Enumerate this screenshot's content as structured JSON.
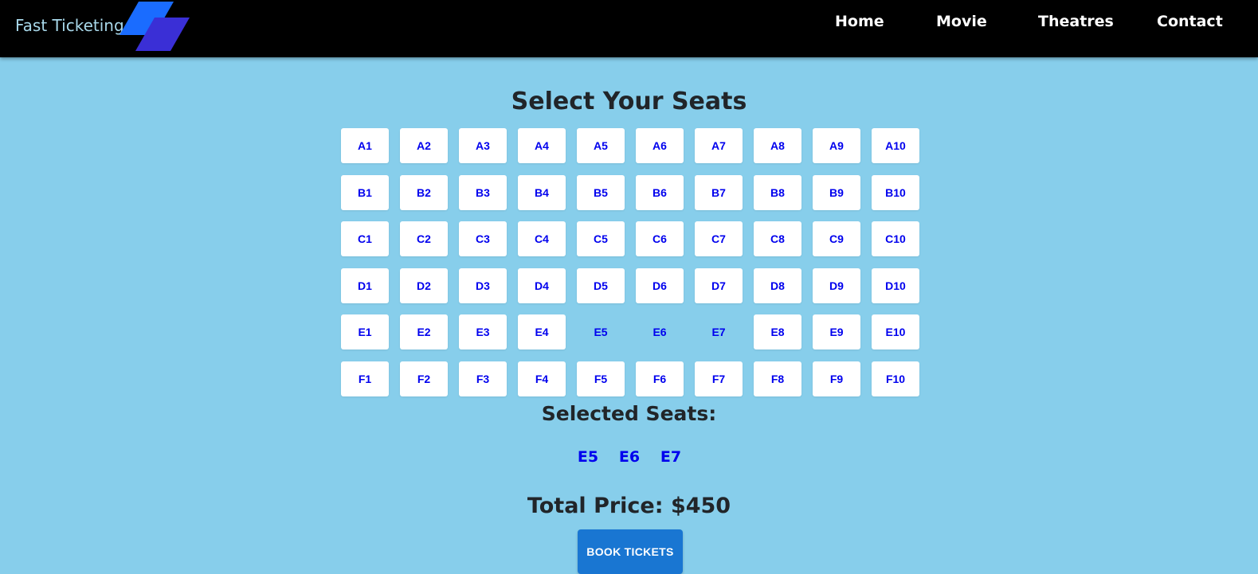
{
  "brand": {
    "name": "Fast Ticketing"
  },
  "nav": {
    "home": "Home",
    "movie": "Movie",
    "theatres": "Theatres",
    "contact": "Contact"
  },
  "page": {
    "title": "Select Your Seats"
  },
  "colors": {
    "background": "#87ceeb",
    "navbar": "#000000",
    "seat_text": "#0000ee",
    "book_button": "#1976d2",
    "logo_front": "#1a6cff",
    "logo_back": "#3a2fd6"
  },
  "seats": {
    "rows": [
      [
        "A1",
        "A2",
        "A3",
        "A4",
        "A5",
        "A6",
        "A7",
        "A8",
        "A9",
        "A10"
      ],
      [
        "B1",
        "B2",
        "B3",
        "B4",
        "B5",
        "B6",
        "B7",
        "B8",
        "B9",
        "B10"
      ],
      [
        "C1",
        "C2",
        "C3",
        "C4",
        "C5",
        "C6",
        "C7",
        "C8",
        "C9",
        "C10"
      ],
      [
        "D1",
        "D2",
        "D3",
        "D4",
        "D5",
        "D6",
        "D7",
        "D8",
        "D9",
        "D10"
      ],
      [
        "E1",
        "E2",
        "E3",
        "E4",
        "E5",
        "E6",
        "E7",
        "E8",
        "E9",
        "E10"
      ],
      [
        "F1",
        "F2",
        "F3",
        "F4",
        "F5",
        "F6",
        "F7",
        "F8",
        "F9",
        "F10"
      ]
    ],
    "selected": [
      "E5",
      "E6",
      "E7"
    ]
  },
  "summary": {
    "selected_label": "Selected Seats:",
    "selected_list": [
      "E5",
      "E6",
      "E7"
    ],
    "total_label": "Total Price: $450"
  },
  "actions": {
    "book_label": "BOOK TICKETS"
  }
}
